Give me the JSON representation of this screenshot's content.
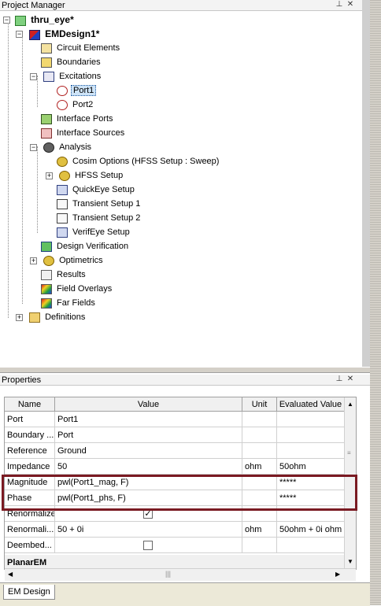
{
  "project_manager": {
    "title": "Project Manager",
    "pin_icon": "pin-icon",
    "close_icon": "close-icon",
    "tree": [
      {
        "label": "thru_eye*",
        "bold": true
      },
      {
        "label": "EMDesign1*",
        "bold": true
      },
      {
        "label": "Circuit Elements"
      },
      {
        "label": "Boundaries"
      },
      {
        "label": "Excitations"
      },
      {
        "label": "Port1",
        "selected": true
      },
      {
        "label": "Port2"
      },
      {
        "label": "Interface Ports"
      },
      {
        "label": "Interface Sources"
      },
      {
        "label": "Analysis"
      },
      {
        "label": "Cosim Options (HFSS Setup : Sweep)"
      },
      {
        "label": "HFSS Setup"
      },
      {
        "label": "QuickEye Setup"
      },
      {
        "label": "Transient Setup 1"
      },
      {
        "label": "Transient Setup 2"
      },
      {
        "label": "VerifEye Setup"
      },
      {
        "label": "Design Verification"
      },
      {
        "label": "Optimetrics"
      },
      {
        "label": "Results"
      },
      {
        "label": "Field Overlays"
      },
      {
        "label": "Far Fields"
      },
      {
        "label": "Definitions"
      }
    ]
  },
  "properties": {
    "title": "Properties",
    "columns": {
      "name": "Name",
      "value": "Value",
      "unit": "Unit",
      "evaluated": "Evaluated Value"
    },
    "rows": [
      {
        "name": "Port",
        "value": "Port1",
        "unit": "",
        "evaluated": ""
      },
      {
        "name": "Boundary ...",
        "value": "Port",
        "unit": "",
        "evaluated": ""
      },
      {
        "name": "Reference",
        "value": "Ground",
        "unit": "",
        "evaluated": ""
      },
      {
        "name": "Impedance",
        "value": "50",
        "unit": "ohm",
        "evaluated": "50ohm"
      },
      {
        "name": "Magnitude",
        "value": "pwl(Port1_mag, F)",
        "unit": "",
        "evaluated": "*****"
      },
      {
        "name": "Phase",
        "value": "pwl(Port1_phs, F)",
        "unit": "",
        "evaluated": "*****"
      },
      {
        "name": "Renormalize",
        "value": "",
        "unit": "",
        "evaluated": "",
        "checkbox": true,
        "checked": true
      },
      {
        "name": "Renormali...",
        "value": "50 + 0i",
        "unit": "ohm",
        "evaluated": "50ohm + 0i ohm"
      },
      {
        "name": "Deembed...",
        "value": "",
        "unit": "",
        "evaluated": "",
        "checkbox": true,
        "checked": false
      }
    ],
    "section": "PlanarEM"
  },
  "bottom_tab": {
    "label": "EM Design"
  },
  "colors": {
    "highlight_border": "#7a1a22",
    "selection": "#cde3f7"
  }
}
